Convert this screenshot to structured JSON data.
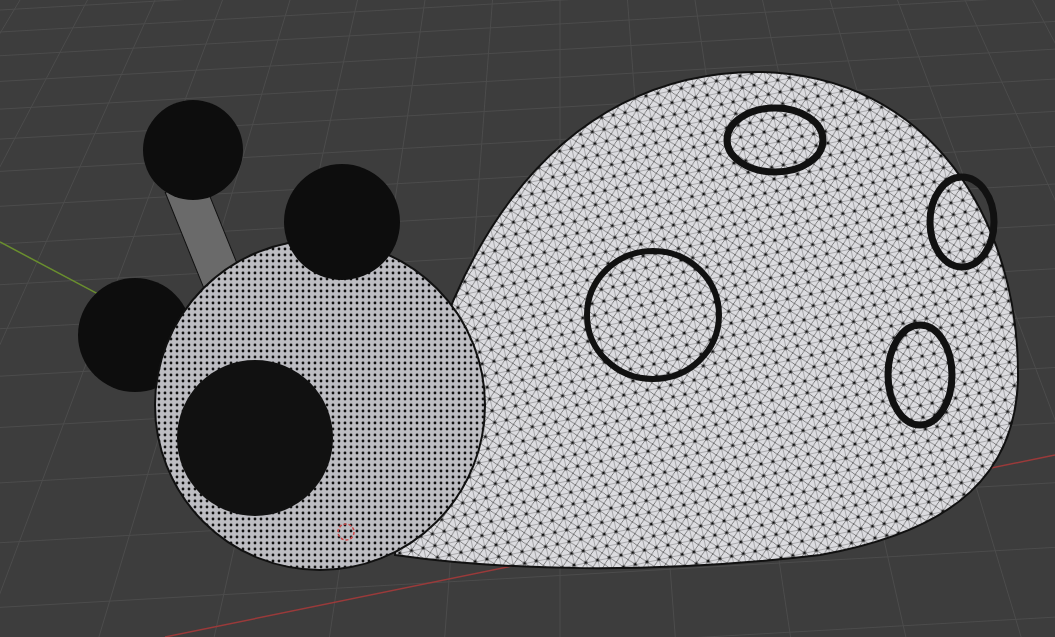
{
  "viewport": {
    "show_grid": true,
    "show_axes": true,
    "show_wireframe": true,
    "show_3d_cursor": true
  }
}
